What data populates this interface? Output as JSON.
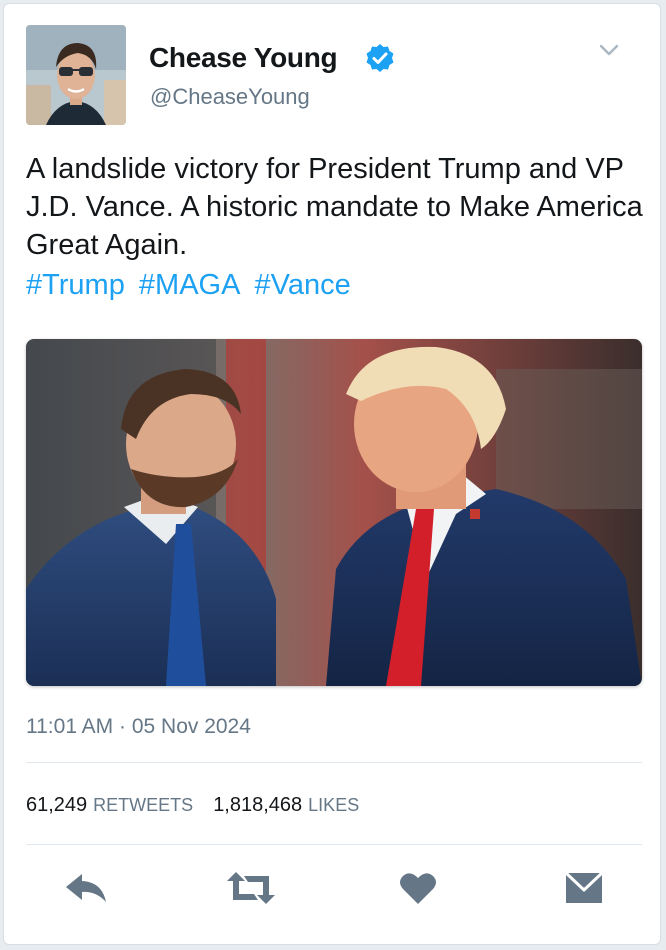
{
  "user": {
    "display_name": "Chease Young",
    "handle": "@CheaseYoung",
    "verified": true,
    "avatar_icon": "avatar-photo"
  },
  "tweet": {
    "text": "A landslide victory for President Trump and VP J.D. Vance. A historic mandate to Make America Great Again.",
    "hashtags": [
      "#Trump",
      "#MAGA",
      "#Vance"
    ],
    "timestamp": "11:01 AM · 05 Nov 2024"
  },
  "stats": {
    "retweets": "61,249",
    "retweets_label": "RETWEETS",
    "likes": "1,818,468",
    "likes_label": "LIKES"
  },
  "actions": {
    "reply_icon": "reply-icon",
    "retweet_icon": "retweet-icon",
    "like_icon": "heart-icon",
    "dm_icon": "envelope-icon"
  },
  "colors": {
    "link": "#1da1f2",
    "muted": "#657786",
    "text": "#14171a",
    "icon": "#657786"
  }
}
